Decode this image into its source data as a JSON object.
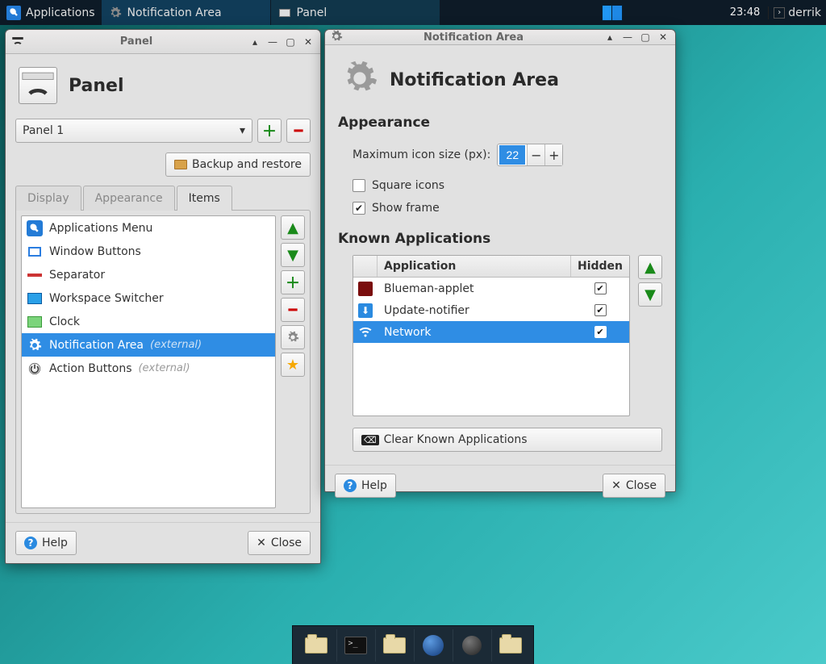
{
  "topbar": {
    "app_menu": "Applications",
    "tasks": [
      {
        "label": "Notification Area",
        "icon": "gear-icon",
        "active": true
      },
      {
        "label": "Panel",
        "icon": "panel-icon",
        "active": false
      }
    ],
    "clock": "23:48",
    "user": "derrik"
  },
  "panel_window": {
    "title": "Panel",
    "header": "Panel",
    "select_value": "Panel 1",
    "backup_btn": "Backup and restore",
    "tabs": {
      "display": "Display",
      "appearance": "Appearance",
      "items": "Items"
    },
    "items": [
      {
        "label": "Applications Menu",
        "icon": "apps-menu-icon"
      },
      {
        "label": "Window Buttons",
        "icon": "window-buttons-icon"
      },
      {
        "label": "Separator",
        "icon": "separator-icon"
      },
      {
        "label": "Workspace Switcher",
        "icon": "workspace-icon"
      },
      {
        "label": "Clock",
        "icon": "clock-icon"
      },
      {
        "label": "Notification Area",
        "icon": "gear-icon",
        "ext": "(external)",
        "selected": true
      },
      {
        "label": "Action Buttons",
        "icon": "power-icon",
        "ext": "(external)"
      }
    ],
    "help": "Help",
    "close": "Close"
  },
  "notif_window": {
    "title": "Notification Area",
    "header": "Notification Area",
    "sec_appearance": "Appearance",
    "max_icon_label": "Maximum icon size (px):",
    "max_icon_value": "22",
    "square_icons": "Square icons",
    "show_frame": "Show frame",
    "sec_known": "Known Applications",
    "col_app": "Application",
    "col_hidden": "Hidden",
    "apps": [
      {
        "name": "Blueman-applet",
        "hidden": true,
        "icon": "bluetooth-icon",
        "selected": false
      },
      {
        "name": "Update-notifier",
        "hidden": true,
        "icon": "update-icon",
        "selected": false
      },
      {
        "name": "Network",
        "hidden": true,
        "icon": "wifi-icon",
        "selected": true
      }
    ],
    "clear_btn": "Clear Known Applications",
    "help": "Help",
    "close": "Close"
  }
}
